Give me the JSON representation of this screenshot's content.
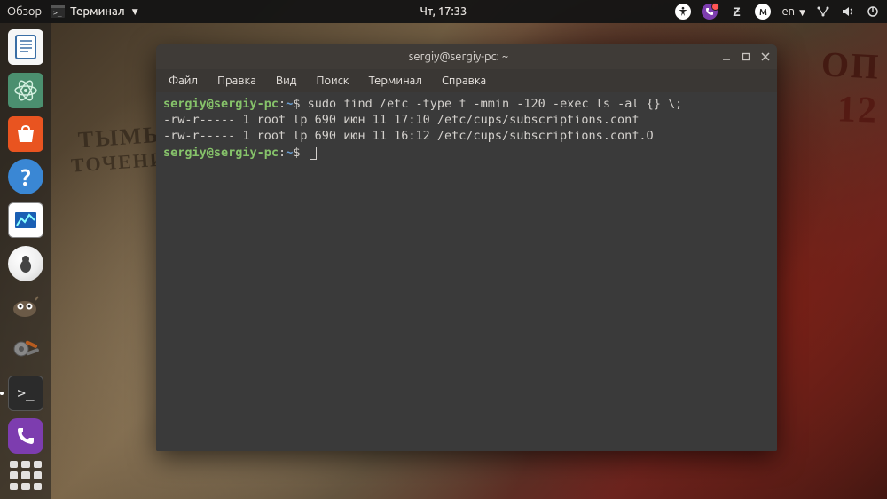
{
  "top_panel": {
    "activities": "Обзор",
    "app_name": "Терминал",
    "clock": "Чт, 17:33",
    "lang_indicator": "en"
  },
  "terminal_window": {
    "title": "sergiy@sergiy-pc: ~",
    "menu": {
      "file": "Файл",
      "edit": "Правка",
      "view": "Вид",
      "search": "Поиск",
      "terminal": "Терминал",
      "help": "Справка"
    },
    "session": {
      "prompt_user": "sergiy@sergiy-pc",
      "prompt_path": "~",
      "prompt_symbol": "$",
      "lines": [
        {
          "type": "cmd",
          "command": "sudo find /etc -type f -mmin -120 -exec ls -al {} \\;"
        },
        {
          "type": "out",
          "text": "-rw-r----- 1 root lp 690 июн 11 17:10 /etc/cups/subscriptions.conf"
        },
        {
          "type": "out",
          "text": "-rw-r----- 1 root lp 690 июн 11 16:12 /etc/cups/subscriptions.conf.O"
        },
        {
          "type": "cmd",
          "command": ""
        }
      ]
    }
  }
}
